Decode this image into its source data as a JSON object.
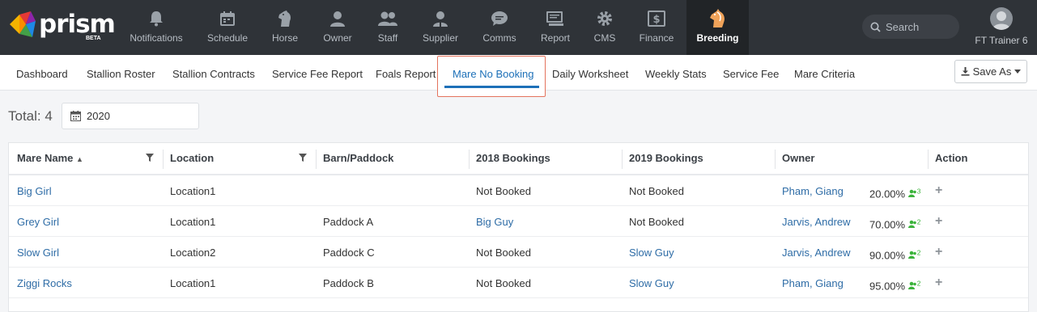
{
  "brand": {
    "name": "prism",
    "tag": "BETA"
  },
  "nav": [
    {
      "label": "Notifications",
      "icon": "bell-icon"
    },
    {
      "label": "Schedule",
      "icon": "calendar-icon"
    },
    {
      "label": "Horse",
      "icon": "horse-head-icon"
    },
    {
      "label": "Owner",
      "icon": "person-icon"
    },
    {
      "label": "Staff",
      "icon": "people-icon"
    },
    {
      "label": "Supplier",
      "icon": "supplier-icon"
    },
    {
      "label": "Comms",
      "icon": "chat-bubble-icon"
    },
    {
      "label": "Report",
      "icon": "report-icon"
    },
    {
      "label": "CMS",
      "icon": "gear-icon"
    },
    {
      "label": "Finance",
      "icon": "dollar-icon"
    },
    {
      "label": "Breeding",
      "icon": "breeding-horse-icon",
      "active": true
    }
  ],
  "search": {
    "placeholder": "Search"
  },
  "user": {
    "name": "FT Trainer 6"
  },
  "tabs": [
    {
      "label": "Dashboard"
    },
    {
      "label": "Stallion Roster"
    },
    {
      "label": "Stallion Contracts"
    },
    {
      "label": "Service Fee Report"
    },
    {
      "label": "Foals Report"
    },
    {
      "label": "Mare No Booking",
      "active": true
    },
    {
      "label": "Daily Worksheet"
    },
    {
      "label": "Weekly Stats"
    },
    {
      "label": "Service Fee"
    },
    {
      "label": "Mare Criteria"
    }
  ],
  "save_as": {
    "label": "Save As"
  },
  "total": {
    "label": "Total: 4"
  },
  "year": {
    "value": "2020"
  },
  "table": {
    "columns": [
      "Mare Name",
      "Location",
      "Barn/Paddock",
      "2018 Bookings",
      "2019 Bookings",
      "Owner",
      "Action"
    ],
    "rows": [
      {
        "mare": "Big Girl",
        "location": "Location1",
        "barn": "",
        "b2018": "Not Booked",
        "b2019": "Not Booked",
        "owner": "Pham, Giang",
        "pct": "20.00%",
        "owners_count": "3"
      },
      {
        "mare": "Grey Girl",
        "location": "Location1",
        "barn": "Paddock A",
        "b2018": "Big Guy",
        "b2019": "Not Booked",
        "owner": "Jarvis, Andrew",
        "pct": "70.00%",
        "owners_count": "2"
      },
      {
        "mare": "Slow Girl",
        "location": "Location2",
        "barn": "Paddock C",
        "b2018": "Not Booked",
        "b2019": "Slow Guy",
        "owner": "Jarvis, Andrew",
        "pct": "90.00%",
        "owners_count": "2"
      },
      {
        "mare": "Ziggi Rocks",
        "location": "Location1",
        "barn": "Paddock B",
        "b2018": "Not Booked",
        "b2019": "Slow Guy",
        "owner": "Pham, Giang",
        "pct": "95.00%",
        "owners_count": "2"
      }
    ]
  },
  "colors": {
    "topbar": "#2f3338",
    "accent": "#1d70b8",
    "link": "#2e6ca6",
    "highlight": "#e4735d",
    "owners_badge": "#3bb33b"
  }
}
